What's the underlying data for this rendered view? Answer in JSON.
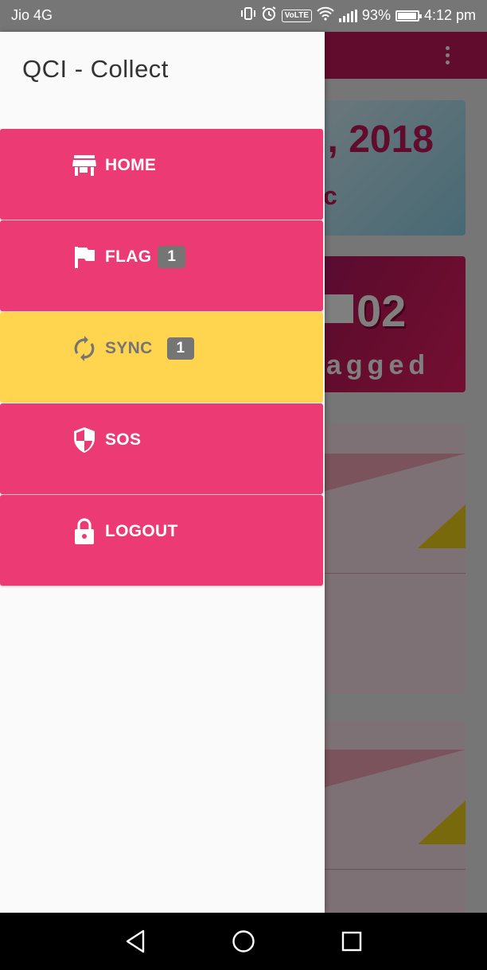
{
  "status_bar": {
    "carrier": "Jio 4G",
    "volte": "VoLTE",
    "battery": "93%",
    "time": "4:12 pm"
  },
  "background": {
    "date_text": ", 2018",
    "date_sub": "c",
    "flag_count": "02",
    "flag_label": "agged"
  },
  "drawer": {
    "title": "QCI - Collect",
    "items": [
      {
        "label": "HOME",
        "icon": "store-icon"
      },
      {
        "label": "FLAG",
        "icon": "flag-icon",
        "badge": "1"
      },
      {
        "label": "SYNC",
        "icon": "sync-icon",
        "badge": "1",
        "active": true
      },
      {
        "label": "SOS",
        "icon": "shield-icon"
      },
      {
        "label": "LOGOUT",
        "icon": "lock-icon"
      }
    ]
  },
  "colors": {
    "menu_item": "#ec3b74",
    "menu_active": "#ffd54f",
    "appbar": "#c2185b",
    "badge": "#757575"
  }
}
